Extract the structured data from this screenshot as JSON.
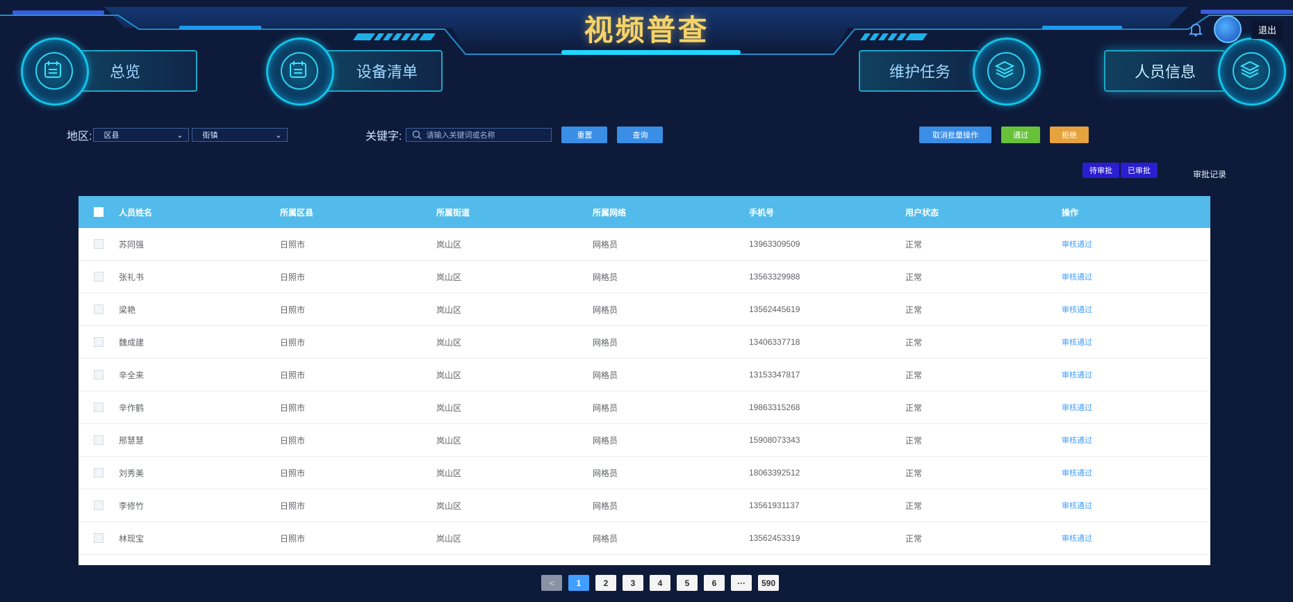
{
  "header": {
    "title": "视频普查",
    "logout": "退出"
  },
  "nav": [
    {
      "label": "总览"
    },
    {
      "label": "设备清单"
    },
    {
      "label": "维护任务"
    },
    {
      "label": "人员信息"
    }
  ],
  "filters": {
    "region_label": "地区:",
    "district": "区县",
    "town": "街镇",
    "keyword_label": "关键字:",
    "keyword_placeholder": "请输入关键词或名称",
    "reset": "重置",
    "query": "查询"
  },
  "batch": {
    "cancel": "取消批量操作",
    "pass": "通过",
    "reject": "拒绝"
  },
  "tabs": {
    "pending": "待审批",
    "approved": "已审批",
    "records": "审批记录"
  },
  "table": {
    "columns": [
      "人员姓名",
      "所属区县",
      "所属街道",
      "所属网络",
      "手机号",
      "用户状态",
      "操作"
    ],
    "rows": [
      [
        "苏同强",
        "日照市",
        "岚山区",
        "网格员",
        "13963309509",
        "正常",
        "审核通过"
      ],
      [
        "张礼书",
        "日照市",
        "岚山区",
        "网格员",
        "13563329988",
        "正常",
        "审核通过"
      ],
      [
        "梁艳",
        "日照市",
        "岚山区",
        "网格员",
        "13562445619",
        "正常",
        "审核通过"
      ],
      [
        "魏成建",
        "日照市",
        "岚山区",
        "网格员",
        "13406337718",
        "正常",
        "审核通过"
      ],
      [
        "辛全来",
        "日照市",
        "岚山区",
        "网格员",
        "13153347817",
        "正常",
        "审核通过"
      ],
      [
        "辛作鹤",
        "日照市",
        "岚山区",
        "网格员",
        "19863315268",
        "正常",
        "审核通过"
      ],
      [
        "邢慧慧",
        "日照市",
        "岚山区",
        "网格员",
        "15908073343",
        "正常",
        "审核通过"
      ],
      [
        "刘秀美",
        "日照市",
        "岚山区",
        "网格员",
        "18063392512",
        "正常",
        "审核通过"
      ],
      [
        "李修竹",
        "日照市",
        "岚山区",
        "网格员",
        "13561931137",
        "正常",
        "审核通过"
      ],
      [
        "林现宝",
        "日照市",
        "岚山区",
        "网格员",
        "13562453319",
        "正常",
        "审核通过"
      ]
    ]
  },
  "pagination": {
    "pages": [
      "1",
      "2",
      "3",
      "4",
      "5",
      "6"
    ],
    "ellipsis": "···",
    "last": "590",
    "current": "1",
    "prev": "<"
  },
  "colors": {
    "background": "#0e1a3a",
    "title": "#f5d36a",
    "table_header": "#53bbeb",
    "link": "#409eff"
  }
}
